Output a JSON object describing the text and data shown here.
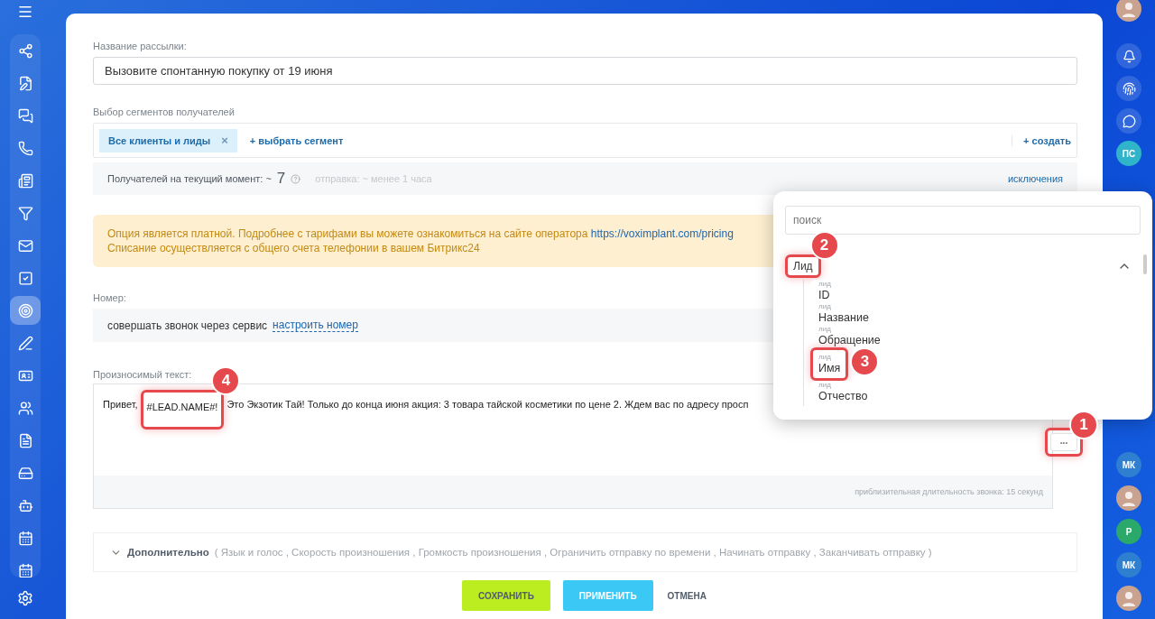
{
  "sidebar": {
    "items": [
      {
        "selected": false
      },
      {
        "selected": false
      },
      {
        "selected": false
      },
      {
        "selected": false
      },
      {
        "selected": false
      },
      {
        "selected": false
      },
      {
        "selected": false
      },
      {
        "selected": false
      },
      {
        "selected": true
      },
      {
        "selected": false
      },
      {
        "selected": false
      },
      {
        "selected": false
      },
      {
        "selected": false
      },
      {
        "selected": false
      },
      {
        "selected": false
      },
      {
        "selected": false
      },
      {
        "selected": false
      }
    ]
  },
  "form": {
    "name_label": "Название рассылки:",
    "name_value": "Вызовите спонтанную покупку от 19 июня",
    "segments_label": "Выбор сегментов получателей",
    "segment_tags": [
      "Все клиенты и лиды"
    ],
    "tag_remove": "×",
    "add_segment": "+ выбрать сегмент",
    "create": "+ создать",
    "recipients_label": "Получателей на текущий момент: ~",
    "recipients_count": "7",
    "send_time": "отправка: ~ менее 1 часа",
    "exclusions": "исключения",
    "notice": {
      "text": "Опция является платной. Подробнее с тарифами вы можете ознакомиться на сайте оператора",
      "link": "https://voximplant.com/pricing",
      "line2": "Списание осуществляется с общего счета телефонии в вашем Битрикс24"
    },
    "number_label": "Номер:",
    "number_text": "совершать звонок через сервис",
    "number_link": "настроить номер",
    "speech_label": "Произносимый текст:",
    "speech_parts": [
      {
        "text": "Привет,",
        "highlighted": false
      },
      {
        "text": "#LEAD.NAME#!",
        "highlighted": true,
        "callout": "4"
      },
      {
        "text": "Это Экзотик Тай! Только до конца июня акция: 3 товара тайской косметики по цене 2. Ждем вас по адресу просп",
        "highlighted": false
      }
    ],
    "more_button": {
      "label": "•••",
      "highlighted": true,
      "callout": "1"
    },
    "duration": "приблизительная длительность звонка: 15 секунд",
    "advanced": {
      "title": "Дополнительно",
      "options": "( Язык и голос ,  Скорость произношения ,  Громкость произношения ,  Ограничить отправку по времени ,  Начинать отправку ,  Заканчивать отправку  )",
      "expanded": false
    }
  },
  "buttons": [
    {
      "label": "СОХРАНИТЬ",
      "kind": "save"
    },
    {
      "label": "ПРИМЕНИТЬ",
      "kind": "apply"
    },
    {
      "label": "ОТМЕНА",
      "kind": "cancel"
    }
  ],
  "popup": {
    "search_placeholder": "поиск",
    "group": {
      "title": "Лид",
      "highlighted": true,
      "callout": "2",
      "expanded": true,
      "fields": [
        {
          "category": "лид",
          "name": "ID",
          "highlighted": false
        },
        {
          "category": "лид",
          "name": "Название",
          "highlighted": false
        },
        {
          "category": "лид",
          "name": "Обращение",
          "highlighted": false
        },
        {
          "category": "лид",
          "name": "Имя",
          "highlighted": true,
          "callout": "3"
        },
        {
          "category": "лид",
          "name": "Отчество",
          "highlighted": false
        }
      ]
    }
  },
  "right_bar": {
    "top": [
      {
        "kind": "avatar"
      },
      {
        "kind": "bell"
      },
      {
        "kind": "icon"
      },
      {
        "kind": "chat"
      },
      {
        "kind": "initials",
        "text": "ПС",
        "color": "#2fb4c9"
      }
    ],
    "bottom": [
      {
        "kind": "initials",
        "text": "МК",
        "color": "#2f7fd0"
      },
      {
        "kind": "avatar"
      },
      {
        "kind": "initials",
        "text": "Р",
        "color": "#2aa96b"
      },
      {
        "kind": "initials",
        "text": "МК",
        "color": "#2f7fd0"
      },
      {
        "kind": "avatar"
      }
    ]
  }
}
